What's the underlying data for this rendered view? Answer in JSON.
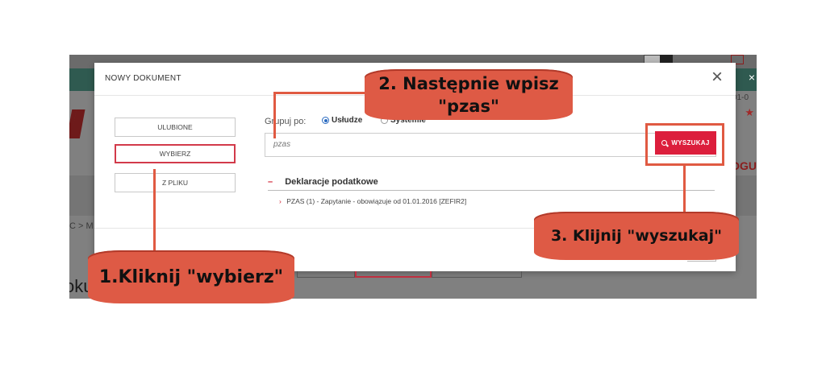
{
  "modal": {
    "title": "NOWY DOKUMENT",
    "close": "×",
    "nav": {
      "favorites": "ULUBIONE",
      "choose": "WYBIERZ",
      "from_file": "Z PLIKU"
    },
    "group_by_label": "Grupuj po:",
    "group_options": [
      "Usłudze",
      "Systemie"
    ],
    "group_selected": "Usłudze",
    "search_value": "pzas",
    "search_button": "WYSZUKAJ",
    "section_title": "Deklaracje podatkowe",
    "section_toggle": "–",
    "results": [
      "PZAS (1) - Zapytanie - obowiązuje od 01.01.2016 [ZEFIR2]"
    ],
    "result_chevron": "›"
  },
  "callouts": {
    "step1": "1.Kliknij \"wybierz\"",
    "step2": "2. Następnie wpisz \"pzas\"",
    "step3": "3. Klijnij \"wyszukaj\""
  },
  "background": {
    "crumb": "C > M",
    "doc": "oku",
    "date": "2-01-0",
    "ogu": "OGU",
    "star": "★",
    "close": "×"
  },
  "colors": {
    "callout": "#de5a45",
    "search_button": "#dc1e3c",
    "active_border": "#d23a4a",
    "teal_bar": "#2f5a50"
  }
}
